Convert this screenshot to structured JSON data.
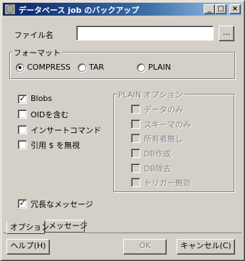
{
  "window": {
    "title": "データベース job のバックアップ",
    "minimize": "_",
    "maximize": "□",
    "close": "×"
  },
  "filename": {
    "label": "ファイル名",
    "value": "",
    "browse_label": "..."
  },
  "format": {
    "group_label": "フォーマット",
    "options": [
      {
        "label": "COMPRESS",
        "selected": true
      },
      {
        "label": "TAR",
        "selected": false
      },
      {
        "label": "PLAIN",
        "selected": false
      }
    ]
  },
  "options": [
    {
      "label": "Blobs",
      "checked": true
    },
    {
      "label": "OIDを含む",
      "checked": false
    },
    {
      "label": "インサートコマンド",
      "checked": false
    },
    {
      "label": "引用 $ を無視",
      "checked": false
    }
  ],
  "plain_options": {
    "group_label": "PLAIN オプション",
    "items": [
      {
        "label": "データのみ",
        "checked": false
      },
      {
        "label": "スキーマのみ",
        "checked": false
      },
      {
        "label": "所有者無し",
        "checked": false
      },
      {
        "label": "DB作成",
        "checked": false
      },
      {
        "label": "DB除去",
        "checked": false
      },
      {
        "label": "トリガー無効",
        "checked": false
      }
    ]
  },
  "verbose": {
    "label": "冗長なメッセージ",
    "checked": true
  },
  "tabs": [
    {
      "label": "オプション",
      "active": true
    },
    {
      "label": "メッセージ",
      "active": false
    }
  ],
  "buttons": {
    "help": "ヘルプ(H)",
    "ok": "OK",
    "cancel": "キャンセル(C)"
  }
}
